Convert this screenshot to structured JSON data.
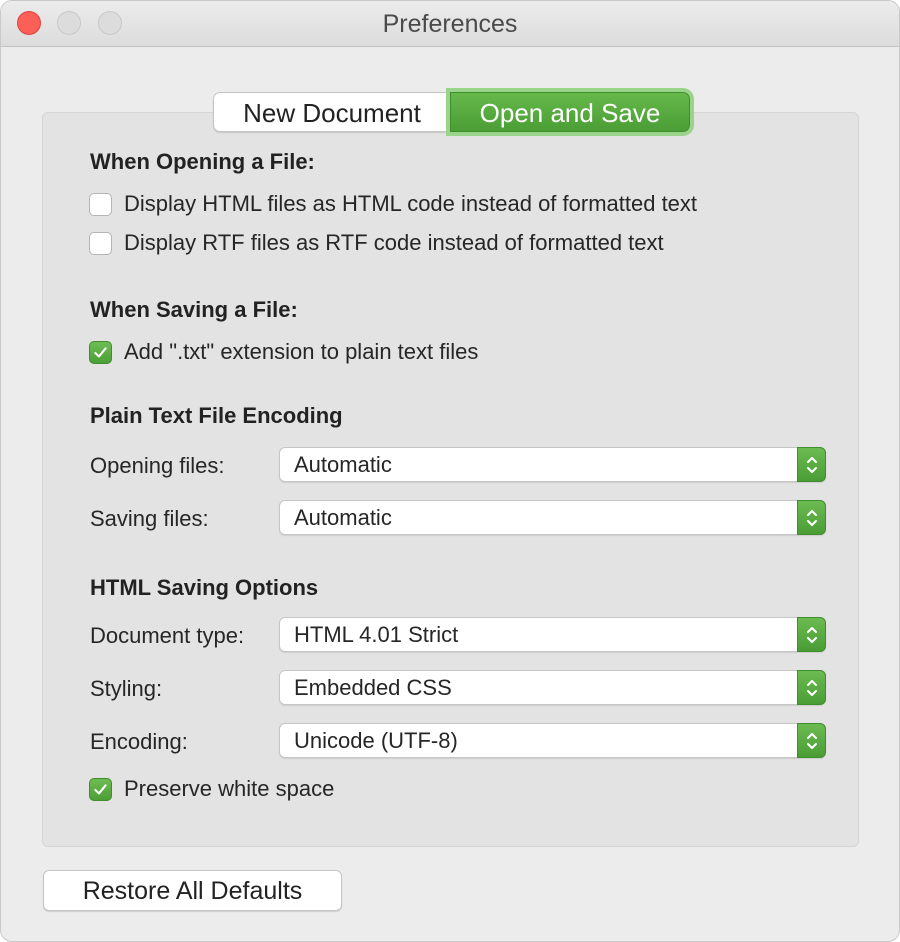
{
  "window": {
    "title": "Preferences"
  },
  "tabs": [
    {
      "label": "New Document",
      "selected": false
    },
    {
      "label": "Open and Save",
      "selected": true
    }
  ],
  "opening": {
    "title": "When Opening a File:",
    "options": [
      {
        "label": "Display HTML files as HTML code instead of formatted text",
        "checked": false
      },
      {
        "label": "Display RTF files as RTF code instead of formatted text",
        "checked": false
      }
    ]
  },
  "saving": {
    "title": "When Saving a File:",
    "options": [
      {
        "label": "Add \".txt\" extension to plain text files",
        "checked": true
      }
    ]
  },
  "encoding": {
    "title": "Plain Text File Encoding",
    "opening_label": "Opening files:",
    "opening_value": "Automatic",
    "saving_label": "Saving files:",
    "saving_value": "Automatic"
  },
  "html": {
    "title": "HTML Saving Options",
    "doctype_label": "Document type:",
    "doctype_value": "HTML 4.01 Strict",
    "styling_label": "Styling:",
    "styling_value": "Embedded CSS",
    "encoding_label": "Encoding:",
    "encoding_value": "Unicode (UTF-8)",
    "preserve_label": "Preserve white space",
    "preserve_checked": true
  },
  "footer": {
    "restore_label": "Restore All Defaults"
  },
  "colors": {
    "accent": "#4ea23a",
    "close_button": "#fc5f57"
  }
}
